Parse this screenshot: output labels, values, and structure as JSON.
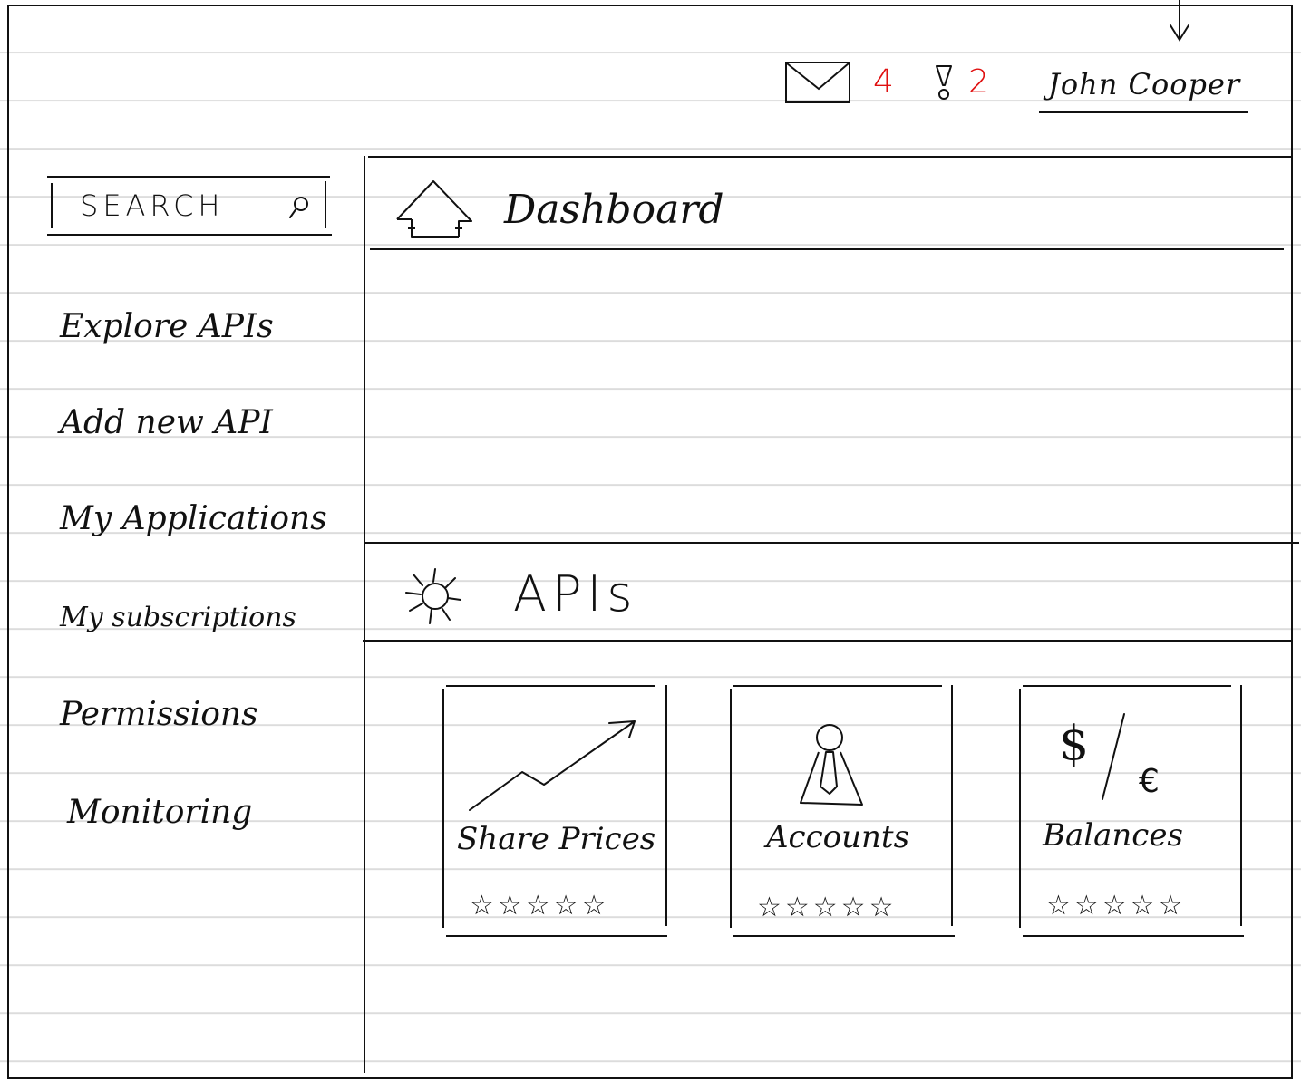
{
  "header": {
    "messages_count": "4",
    "alerts_count": "2",
    "user_name": "John Cooper"
  },
  "search": {
    "placeholder": "SEARCH"
  },
  "sidebar": {
    "items": [
      {
        "label": "Explore APIs"
      },
      {
        "label": "Add new API"
      },
      {
        "label": "My Applications"
      },
      {
        "label": "My subscriptions"
      },
      {
        "label": "Permissions"
      },
      {
        "label": "Monitoring"
      }
    ]
  },
  "dashboard": {
    "title": "Dashboard"
  },
  "apis_section": {
    "title": "APIs",
    "cards": [
      {
        "label": "Share Prices",
        "icon": "trend-chart-icon",
        "rating": 0,
        "rating_max": 5,
        "stars": "☆☆☆☆☆"
      },
      {
        "label": "Accounts",
        "icon": "person-tie-icon",
        "rating": 0,
        "rating_max": 5,
        "stars": "☆☆☆☆☆"
      },
      {
        "label": "Balances",
        "icon": "dollar-euro-icon",
        "rating": 0,
        "rating_max": 5,
        "stars": "☆☆☆☆☆"
      }
    ]
  },
  "colors": {
    "ink": "#111111",
    "badge": "#e01010",
    "ruled_line": "#dcdcdc"
  }
}
